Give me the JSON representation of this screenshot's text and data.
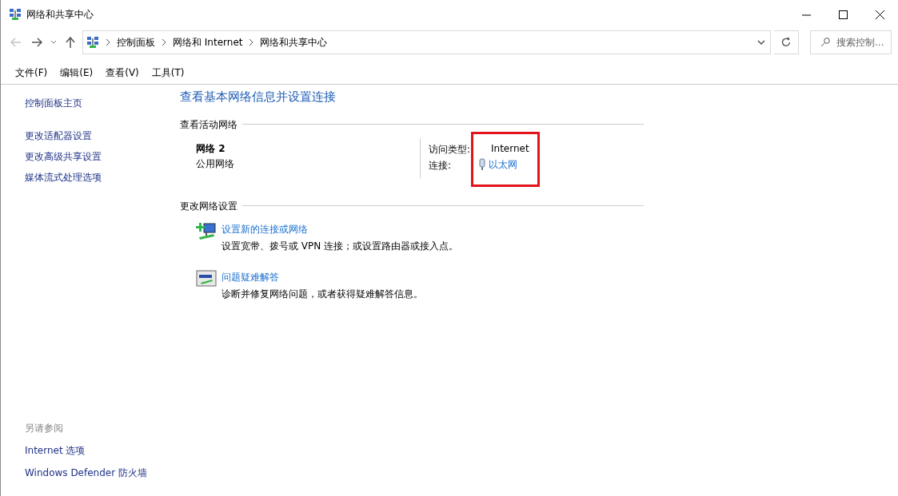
{
  "window": {
    "title": "网络和共享中心"
  },
  "nav": {
    "back_disabled": true,
    "forward_disabled": false
  },
  "breadcrumb": [
    "控制面板",
    "网络和 Internet",
    "网络和共享中心"
  ],
  "search": {
    "placeholder": "搜索控制..."
  },
  "menu": [
    "文件(F)",
    "编辑(E)",
    "查看(V)",
    "工具(T)"
  ],
  "sidebar": {
    "items": [
      "控制面板主页",
      "更改适配器设置",
      "更改高级共享设置",
      "媒体流式处理选项"
    ],
    "see_also_title": "另请参阅",
    "see_also": [
      "Internet 选项",
      "Windows Defender 防火墙"
    ]
  },
  "heading": "查看基本网络信息并设置连接",
  "active_networks": {
    "title": "查看活动网络",
    "name": "网络 2",
    "category": "公用网络",
    "access_label": "访问类型:",
    "access_value": "Internet",
    "connection_label": "连接:",
    "connection_value": "以太网",
    "highlighted": true
  },
  "change_settings": {
    "title": "更改网络设置",
    "tasks": [
      {
        "kind": "new-connection",
        "link": "设置新的连接或网络",
        "description": "设置宽带、拨号或 VPN 连接；或设置路由器或接入点。"
      },
      {
        "kind": "troubleshoot",
        "link": "问题疑难解答",
        "description": "诊断并修复网络问题，或者获得疑难解答信息。"
      }
    ]
  }
}
